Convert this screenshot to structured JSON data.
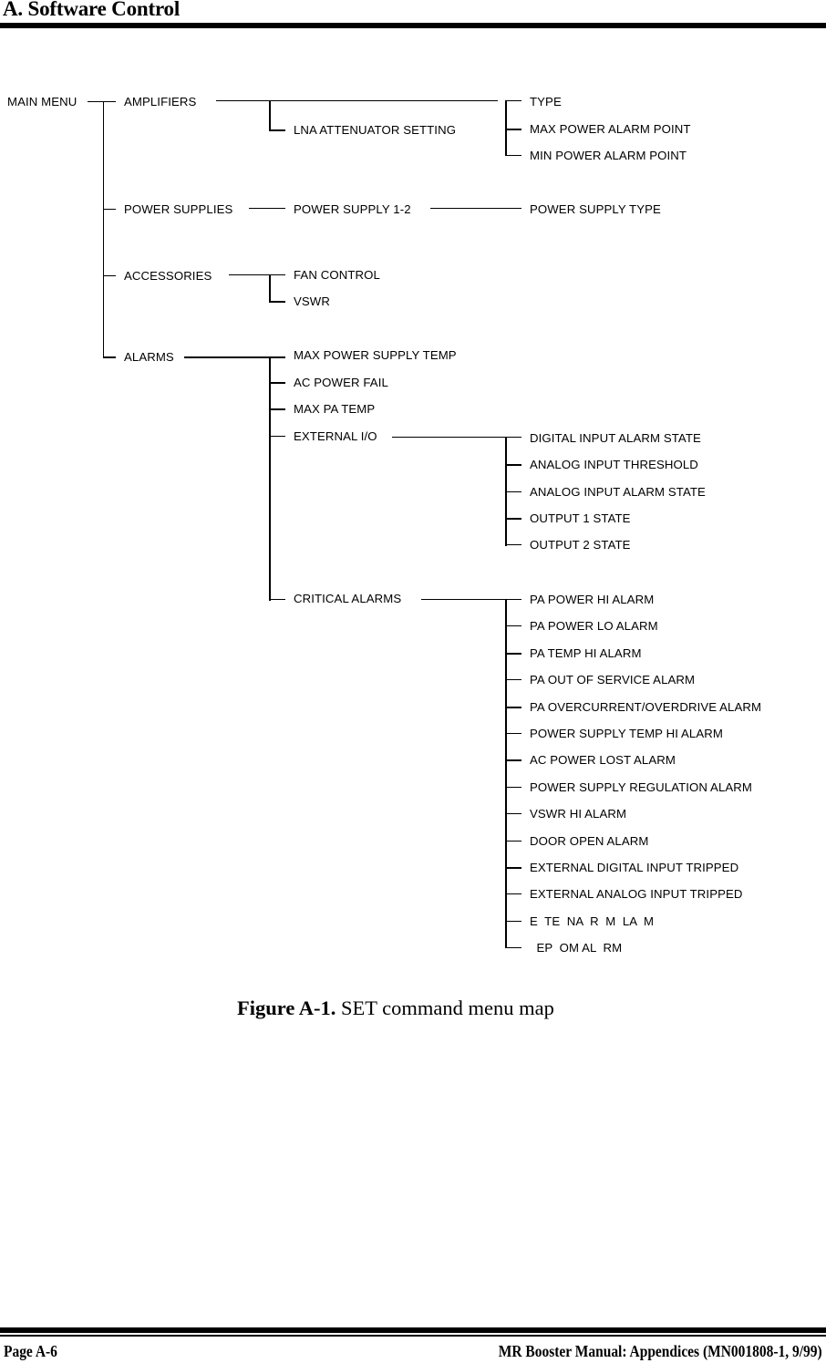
{
  "header": {
    "section_title": "A. Software Control"
  },
  "menu_map": {
    "root": "MAIN MENU",
    "level1": {
      "amplifiers": "AMPLIFIERS",
      "power_supplies": "POWER SUPPLIES",
      "accessories": "ACCESSORIES",
      "alarms": "ALARMS"
    },
    "amplifiers": {
      "lna_attenuator_setting": "LNA ATTENUATOR SETTING",
      "items": [
        "TYPE",
        "MAX POWER ALARM POINT",
        "MIN POWER ALARM POINT"
      ]
    },
    "power_supplies": {
      "power_supply": "POWER SUPPLY 1-2",
      "power_supply_type": "POWER SUPPLY TYPE"
    },
    "accessories": {
      "items": [
        "FAN CONTROL",
        "VSWR"
      ]
    },
    "alarms": {
      "items": [
        "MAX POWER SUPPLY TEMP",
        "AC POWER FAIL",
        "MAX PA TEMP",
        "EXTERNAL I/O",
        "CRITICAL ALARMS"
      ],
      "external_io": [
        "DIGITAL INPUT ALARM STATE",
        "ANALOG INPUT THRESHOLD",
        "ANALOG INPUT ALARM STATE",
        "OUTPUT 1 STATE",
        "OUTPUT 2 STATE"
      ],
      "critical_alarms": [
        "PA POWER HI ALARM",
        "PA POWER LO ALARM",
        "PA TEMP HI ALARM",
        "PA OUT OF SERVICE ALARM",
        "PA OVERCURRENT/OVERDRIVE ALARM",
        "POWER SUPPLY TEMP HI ALARM",
        "AC POWER LOST ALARM",
        "POWER SUPPLY REGULATION ALARM",
        "VSWR HI ALARM",
        "DOOR OPEN ALARM",
        "EXTERNAL DIGITAL INPUT TRIPPED",
        "EXTERNAL ANALOG INPUT TRIPPED",
        "E  TE  NA  R  M  LA  M",
        "  EP  OM AL  RM"
      ]
    }
  },
  "caption": {
    "label": "Figure A-1.",
    "text": " SET command menu map"
  },
  "footer": {
    "page": "Page A-6",
    "document": "MR Booster Manual: Appendices (MN001808-1, 9/99)"
  }
}
